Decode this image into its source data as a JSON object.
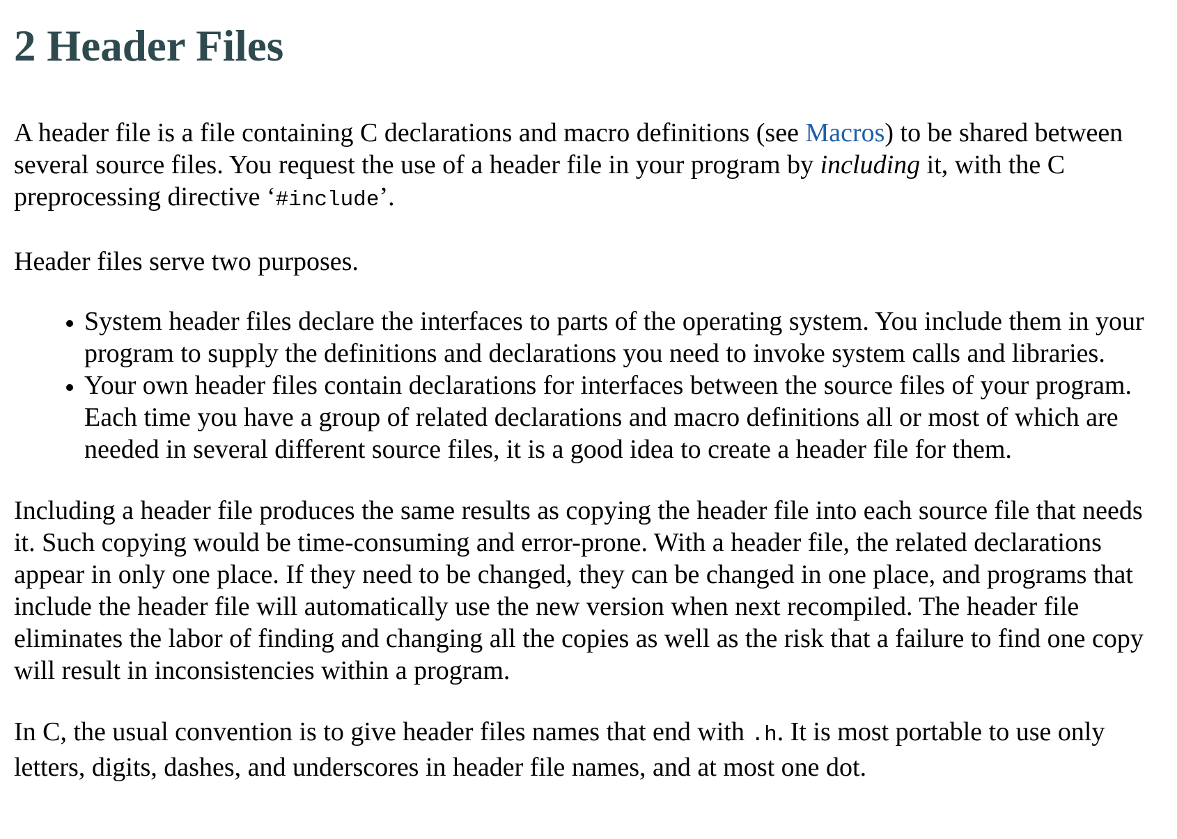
{
  "heading": "2 Header Files",
  "intro": {
    "part1": "A header file is a file containing C declarations and macro definitions (see ",
    "link": "Macros",
    "part2": ") to be shared between several source files. You request the use of a header file in your program by ",
    "emphasis": "including",
    "part3": " it, with the C preprocessing directive ‘",
    "code": "#include",
    "part4": "’."
  },
  "purposes_intro": "Header files serve two purposes.",
  "purposes": [
    "System header files declare the interfaces to parts of the operating system. You include them in your program to supply the definitions and declarations you need to invoke system calls and libraries.",
    "Your own header files contain declarations for interfaces between the source files of your program. Each time you have a group of related declarations and macro definitions all or most of which are needed in several different source files, it is a good idea to create a header file for them."
  ],
  "paragraph_including": "Including a header file produces the same results as copying the header file into each source file that needs it. Such copying would be time-consuming and error-prone. With a header file, the related declarations appear in only one place. If they need to be changed, they can be changed in one place, and programs that include the header file will automatically use the new version when next recompiled. The header file eliminates the labor of finding and changing all the copies as well as the risk that a failure to find one copy will result in inconsistencies within a program.",
  "convention": {
    "part1": "In C, the usual convention is to give header files names that end with ",
    "code": ".h",
    "part2": ". It is most portable to use only letters, digits, dashes, and underscores in header file names, and at most one dot."
  },
  "colors": {
    "heading": "#2f4a4f",
    "link": "#1f5fa8",
    "text": "#000000"
  }
}
